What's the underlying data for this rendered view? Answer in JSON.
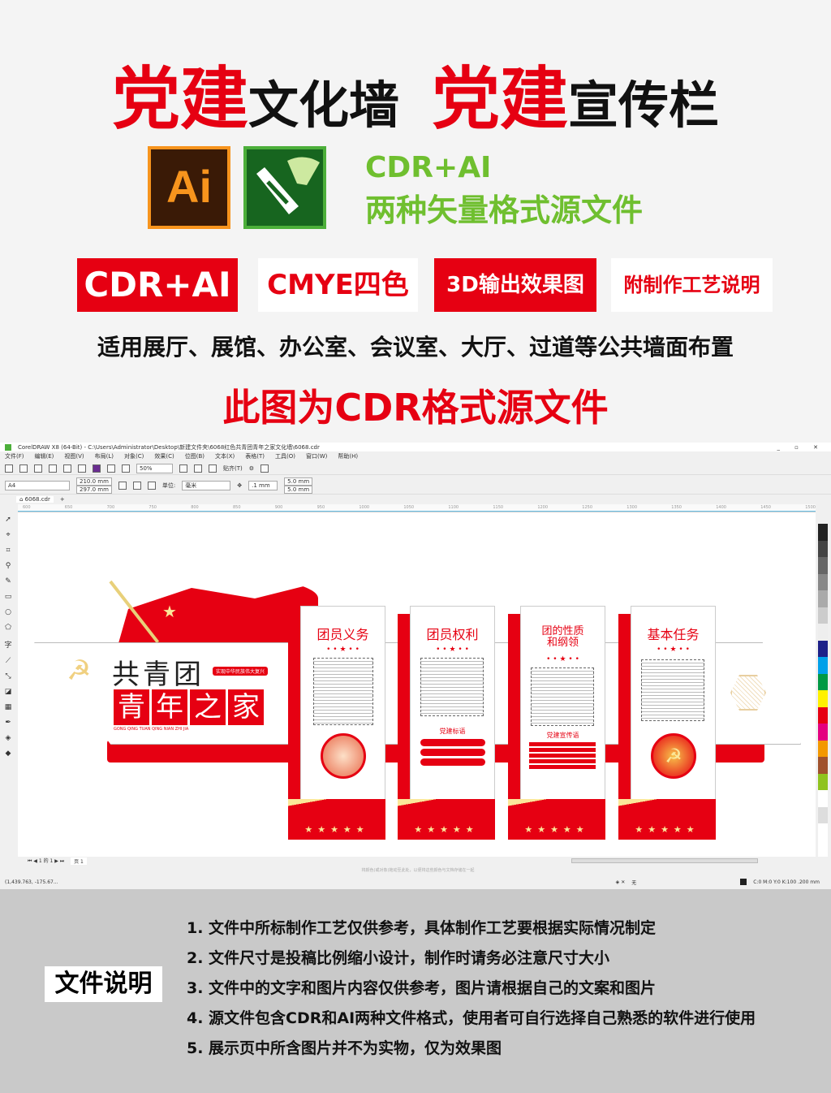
{
  "header": {
    "title_parts": [
      {
        "text": "党建",
        "accent": true
      },
      {
        "text": "文化墙",
        "accent": false
      },
      {
        "text": "  ",
        "accent": false
      },
      {
        "text": "党建",
        "accent": true
      },
      {
        "text": "宣传栏",
        "accent": false
      }
    ],
    "ai_icon": "Ai",
    "format_line1": "CDR+AI",
    "format_line2": "两种矢量格式源文件",
    "badges": [
      "CDR+AI",
      "CMYE四色",
      "3D输出效果图",
      "附制作工艺说明"
    ],
    "usage": "适用展厅、展馆、办公室、会议室、大厅、过道等公共墙面布置",
    "note": "此图为CDR格式源文件"
  },
  "colors": {
    "accent": "#e60012",
    "green": "#6fbf2f",
    "gold": "#fbe79a"
  },
  "app": {
    "title": "CorelDRAW X8 (64-Bit) - C:\\Users\\Administrator\\Desktop\\新建文件夹\\6068红色共青团青年之家文化墙\\6068.cdr",
    "menu": [
      "文件(F)",
      "编辑(E)",
      "视图(V)",
      "布局(L)",
      "对象(C)",
      "效果(C)",
      "位图(B)",
      "文本(X)",
      "表格(T)",
      "工具(O)",
      "窗口(W)",
      "帮助(H)"
    ],
    "zoom": "50%",
    "snap": "贴齐(T)",
    "page_size": "A4",
    "width": "210.0 mm",
    "height": "297.0 mm",
    "unit_label": "单位:",
    "unit": "毫米",
    "nudge": ".1 mm",
    "dup_x": "5.0 mm",
    "dup_y": "5.0 mm",
    "tab": "6068.cdr",
    "ruler": [
      "600",
      "650",
      "700",
      "750",
      "800",
      "850",
      "900",
      "950",
      "1000",
      "1050",
      "1100",
      "1150",
      "1200",
      "1250",
      "1300",
      "1350",
      "1400",
      "1450",
      "1500"
    ],
    "page_nav": "1 的 1",
    "page_tab": "页 1",
    "hint": "将颜色(或对象)拖动至此处，以便将这些颜色与文档存储在一起",
    "coords": "(1,439.763, -175.67...",
    "fill": "无",
    "outline": "C:0 M:0 Y:0 K:100  .200 mm"
  },
  "design": {
    "brand_top": "共青团",
    "brand_main": [
      "青",
      "年",
      "之",
      "家"
    ],
    "slogan": "实现中华民族伟大复兴",
    "pinyin": "GONG QING TUAN QING NIAN ZHI JIA",
    "panels": [
      {
        "title": "团员义务"
      },
      {
        "title": "团员权利",
        "sub": "党建标语"
      },
      {
        "title": "团的性质和纲领",
        "sub": "党建宣传语"
      },
      {
        "title": "基本任务"
      }
    ],
    "stars": "• • ★ • •"
  },
  "footer": {
    "label": "文件说明",
    "items": [
      "1. 文件中所标制作工艺仅供参考，具体制作工艺要根据实际情况制定",
      "2. 文件尺寸是投稿比例缩小设计，制作时请务必注意尺寸大小",
      "3. 文件中的文字和图片内容仅供参考，图片请根据自己的文案和图片",
      "4. 源文件包含CDR和AI两种文件格式，使用者可自行选择自己熟悉的软件进行使用",
      "5. 展示页中所含图片并不为实物，仅为效果图"
    ]
  }
}
